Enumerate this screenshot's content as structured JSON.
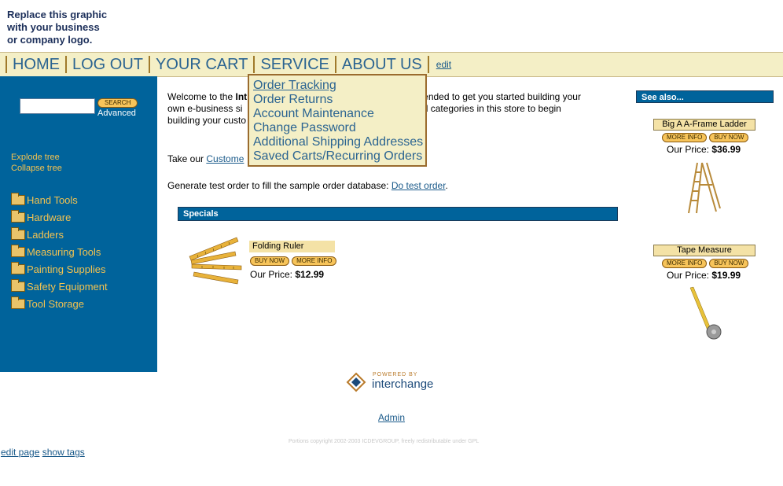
{
  "header": {
    "logo_text": "Replace this graphic\nwith your business\nor company logo."
  },
  "nav": {
    "items": [
      "HOME",
      "LOG OUT",
      "YOUR CART",
      "SERVICE",
      "ABOUT US"
    ],
    "edit": "edit"
  },
  "service_menu": {
    "items": [
      "Order Tracking",
      "Order Returns",
      "Account Maintenance",
      "Change Password",
      "Additional Shipping Addresses",
      "Saved Carts/Recurring Orders"
    ]
  },
  "sidebar": {
    "search_placeholder": "",
    "search_button": "SEARCH",
    "advanced": "Advanced",
    "explode": "Explode tree",
    "collapse": "Collapse tree",
    "categories": [
      "Hand Tools",
      "Hardware",
      "Ladders",
      "Measuring Tools",
      "Painting Supplies",
      "Safety Equipment",
      "Tool Storage"
    ]
  },
  "main": {
    "welcome_prefix": "Welcome to the ",
    "welcome_bold": "Int",
    "welcome_tail": "ntended to get you started building your",
    "line2_left": "own e-business si",
    "line2_right": "and categories in this store to begin",
    "line3": "building your custo",
    "take_our_prefix": "Take our ",
    "take_our_link": "Custome",
    "generate_prefix": "Generate test order to fill the sample order database: ",
    "generate_link": "Do test order",
    "generate_suffix": "."
  },
  "specials": {
    "title": "Specials",
    "product": {
      "name": "Folding Ruler",
      "buy": "BUY NOW",
      "more": "MORE INFO",
      "price_label": "Our Price: ",
      "price": "$12.99"
    }
  },
  "see_also": {
    "title": "See also...",
    "items": [
      {
        "name": "Big A A-Frame Ladder",
        "more": "MORE INFO",
        "buy": "BUY NOW",
        "price_label": "Our Price: ",
        "price": "$36.99"
      },
      {
        "name": "Tape Measure",
        "more": "MORE INFO",
        "buy": "BUY NOW",
        "price_label": "Our Price: ",
        "price": "$19.99"
      }
    ]
  },
  "footer": {
    "powered_by": "POWERED BY",
    "brand": "interchange",
    "admin": "Admin",
    "copyright": "Portions copyright 2002-2003 ICDEVGROUP, freely redistributable under GPL",
    "edit_page": "edit page",
    "show_tags": "show tags"
  }
}
